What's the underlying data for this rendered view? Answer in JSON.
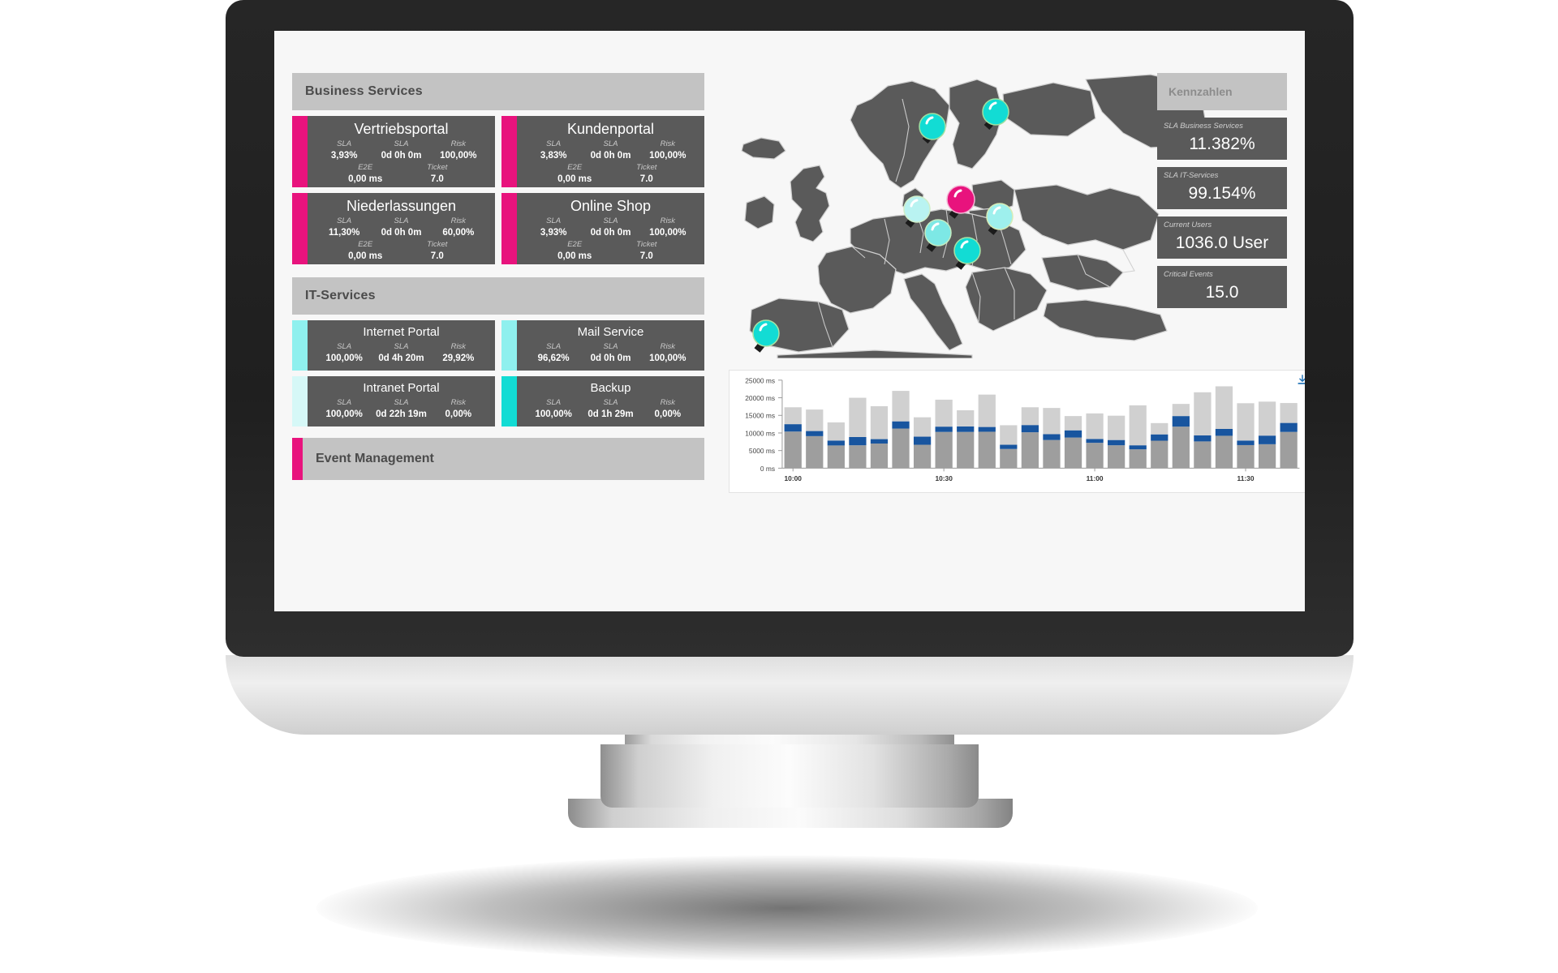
{
  "app": {
    "device": "desktop-monitor"
  },
  "business_services": {
    "header": "Business Services",
    "accent_color": "#e8137d",
    "cards": [
      {
        "title": "Vertriebsportal",
        "bar_color": "#e8137d",
        "metrics_row1": [
          {
            "label": "SLA",
            "value": "3,93%"
          },
          {
            "label": "SLA",
            "value": "0d 0h 0m"
          },
          {
            "label": "Risk",
            "value": "100,00%"
          }
        ],
        "metrics_row2": [
          {
            "label": "E2E",
            "value": "0,00  ms"
          },
          {
            "label": "Ticket",
            "value": "7.0"
          }
        ]
      },
      {
        "title": "Kundenportal",
        "bar_color": "#e8137d",
        "metrics_row1": [
          {
            "label": "SLA",
            "value": "3,83%"
          },
          {
            "label": "SLA",
            "value": "0d 0h 0m"
          },
          {
            "label": "Risk",
            "value": "100,00%"
          }
        ],
        "metrics_row2": [
          {
            "label": "E2E",
            "value": "0,00  ms"
          },
          {
            "label": "Ticket",
            "value": "7.0"
          }
        ]
      },
      {
        "title": "Niederlassungen",
        "bar_color": "#e8137d",
        "metrics_row1": [
          {
            "label": "SLA",
            "value": "11,30%"
          },
          {
            "label": "SLA",
            "value": "0d 0h 0m"
          },
          {
            "label": "Risk",
            "value": "60,00%"
          }
        ],
        "metrics_row2": [
          {
            "label": "E2E",
            "value": "0,00  ms"
          },
          {
            "label": "Ticket",
            "value": "7.0"
          }
        ]
      },
      {
        "title": "Online Shop",
        "bar_color": "#e8137d",
        "metrics_row1": [
          {
            "label": "SLA",
            "value": "3,93%"
          },
          {
            "label": "SLA",
            "value": "0d 0h 0m"
          },
          {
            "label": "Risk",
            "value": "100,00%"
          }
        ],
        "metrics_row2": [
          {
            "label": "E2E",
            "value": "0,00  ms"
          },
          {
            "label": "Ticket",
            "value": "7.0"
          }
        ]
      }
    ]
  },
  "it_services": {
    "header": "IT-Services",
    "cards": [
      {
        "title": "Internet Portal",
        "bar_color": "#8ff0ee",
        "metrics_row1": [
          {
            "label": "SLA",
            "value": "100,00%"
          },
          {
            "label": "SLA",
            "value": "0d 4h 20m"
          },
          {
            "label": "Risk",
            "value": "29,92%"
          }
        ]
      },
      {
        "title": "Mail Service",
        "bar_color": "#8ff0ee",
        "metrics_row1": [
          {
            "label": "SLA",
            "value": "96,62%"
          },
          {
            "label": "SLA",
            "value": "0d 0h 0m"
          },
          {
            "label": "Risk",
            "value": "100,00%"
          }
        ]
      },
      {
        "title": "Intranet Portal",
        "bar_color": "#d6f8f7",
        "metrics_row1": [
          {
            "label": "SLA",
            "value": "100,00%"
          },
          {
            "label": "SLA",
            "value": "0d 22h 19m"
          },
          {
            "label": "Risk",
            "value": "0,00%"
          }
        ]
      },
      {
        "title": "Backup",
        "bar_color": "#12dcd4",
        "metrics_row1": [
          {
            "label": "SLA",
            "value": "100,00%"
          },
          {
            "label": "SLA",
            "value": "0d 1h 29m"
          },
          {
            "label": "Risk",
            "value": "0,00%"
          }
        ]
      }
    ]
  },
  "event_management": {
    "label": "Event Management",
    "bar_color": "#e8137d"
  },
  "kennzahlen": {
    "header": "Kennzahlen",
    "tiles": [
      {
        "label": "SLA Business Services",
        "value": "11.382%"
      },
      {
        "label": "SLA IT-Services",
        "value": "99.154%"
      },
      {
        "label": "Current Users",
        "value": "1036.0 User"
      },
      {
        "label": "Critical Events",
        "value": "15.0"
      }
    ]
  },
  "map": {
    "land_color": "#5a5a5a",
    "border_color": "#cfcfcf",
    "sea_color": "#f7f7f7",
    "markers": [
      {
        "name": "marker-norway",
        "x": 0.425,
        "y": 0.205,
        "color": "#12dcd4"
      },
      {
        "name": "marker-sweden",
        "x": 0.558,
        "y": 0.155,
        "color": "#12dcd4"
      },
      {
        "name": "marker-germany-north",
        "x": 0.485,
        "y": 0.455,
        "color": "#e8137d"
      },
      {
        "name": "marker-netherlands",
        "x": 0.395,
        "y": 0.482,
        "color": "#b9f3f1"
      },
      {
        "name": "marker-czech",
        "x": 0.57,
        "y": 0.51,
        "color": "#9ef0ed"
      },
      {
        "name": "marker-switzerland",
        "x": 0.44,
        "y": 0.535,
        "color": "#7de8e5"
      },
      {
        "name": "marker-italy",
        "x": 0.505,
        "y": 0.58,
        "color": "#12dcd4"
      },
      {
        "name": "marker-portugal",
        "x": 0.185,
        "y": 0.76,
        "color": "#12dcd4"
      }
    ]
  },
  "chart_data": {
    "type": "bar",
    "title": "",
    "xlabel": "",
    "ylabel": "ms",
    "ylim": [
      0,
      25000
    ],
    "yticks": [
      0,
      5000,
      10000,
      15000,
      20000,
      25000
    ],
    "ytick_labels": [
      "0 ms",
      "5000 ms",
      "10000 ms",
      "15000 ms",
      "20000 ms",
      "25000 ms"
    ],
    "xtick_labels": [
      "10:00",
      "10:30",
      "11:00",
      "11:30"
    ],
    "xtick_positions": [
      0,
      7,
      14,
      21
    ],
    "grid": false,
    "legend_position": "none",
    "stacked": true,
    "series": [
      {
        "name": "base",
        "color": "#9e9e9e",
        "values": [
          10400,
          9100,
          6450,
          6500,
          7000,
          11250,
          6650,
          10300,
          10300,
          10350,
          5450,
          10200,
          8000,
          8700,
          7200,
          6500,
          5350,
          7800,
          11800,
          7600,
          9200,
          6550,
          6800,
          10300
        ]
      },
      {
        "name": "highlight",
        "color": "#18559f",
        "values": [
          2100,
          1450,
          1400,
          2350,
          1250,
          2050,
          2300,
          1500,
          1550,
          1350,
          1200,
          2050,
          1650,
          2050,
          1100,
          1500,
          1150,
          1800,
          3000,
          1700,
          1950,
          1300,
          2450,
          2550
        ]
      },
      {
        "name": "remainder",
        "color": "#d0d0d0",
        "values": [
          4800,
          6100,
          5150,
          11150,
          9350,
          8650,
          5500,
          7650,
          4600,
          9200,
          5550,
          5050,
          7450,
          4050,
          7250,
          6900,
          11350,
          3200,
          3450,
          12250,
          12100,
          10600,
          9650,
          5650
        ]
      }
    ]
  },
  "icons": {
    "download": "download-icon"
  }
}
